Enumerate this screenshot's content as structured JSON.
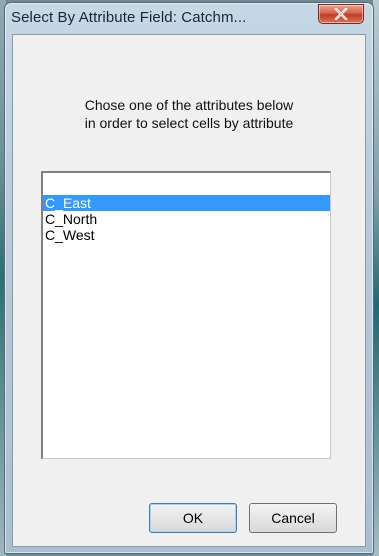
{
  "window": {
    "title": "Select By Attribute  Field: Catchm..."
  },
  "dialog": {
    "instruction_line1": "Chose one of the attributes below",
    "instruction_line2": "in order to select cells by attribute"
  },
  "attribute_list": {
    "selected_index": 1,
    "items": [
      "",
      "C_East",
      "C_North",
      "C_West"
    ]
  },
  "buttons": {
    "ok_label": "OK",
    "cancel_label": "Cancel"
  },
  "icons": {
    "close": "close-icon"
  },
  "colors": {
    "selection": "#3399ff",
    "close_button": "#c13e23"
  }
}
